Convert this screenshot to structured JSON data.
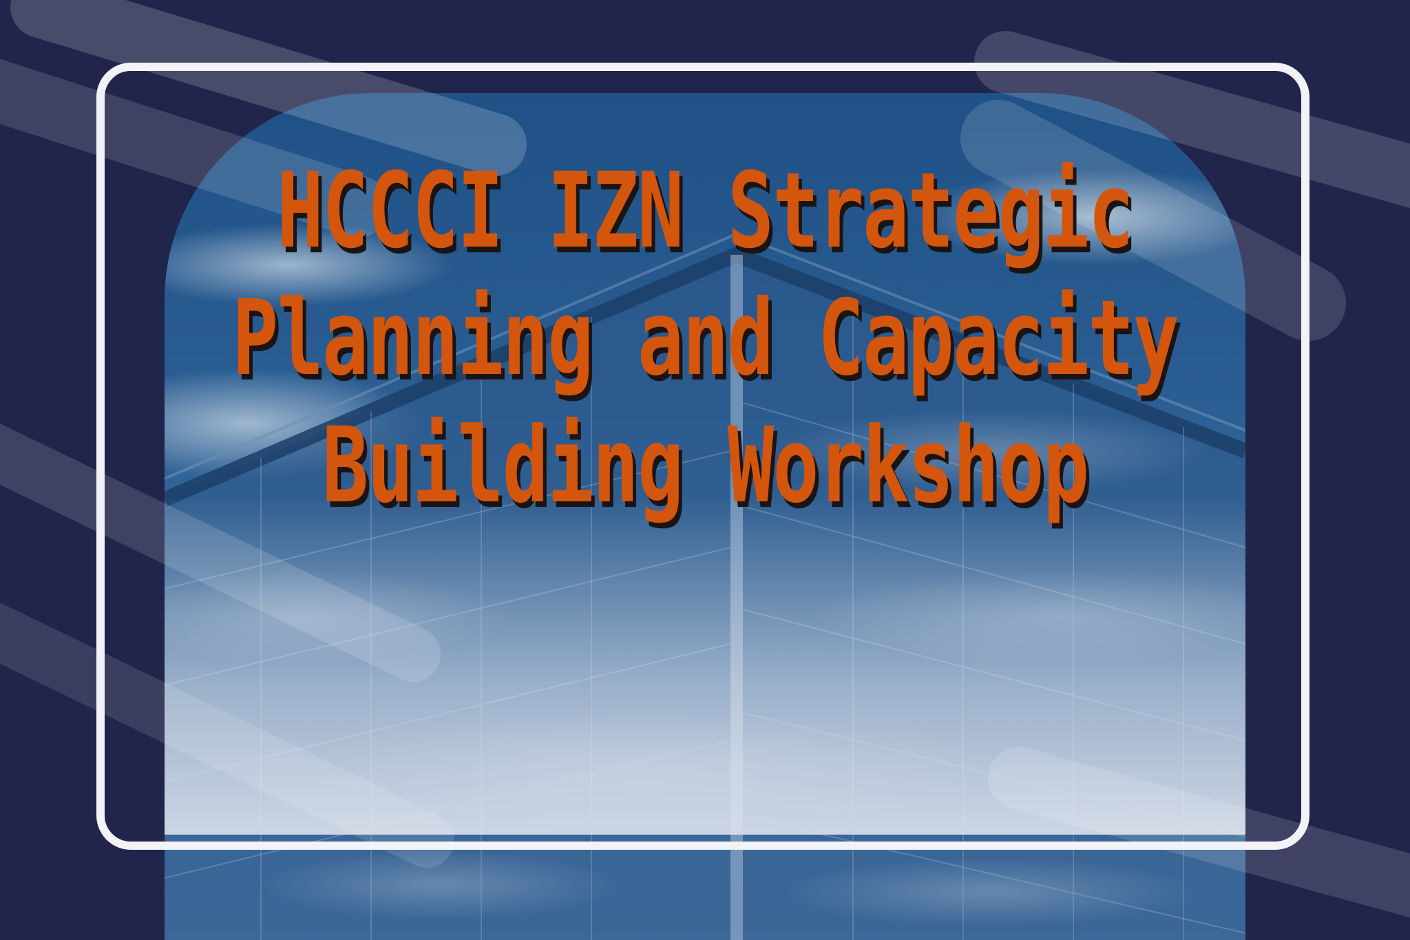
{
  "poster": {
    "title": "HCCCI IZN Strategic Planning and Capacity Building Workshop",
    "title_color": "#d4560c",
    "title_shadow_color": "#1b1414",
    "background_color": "#21244b",
    "frame_color": "#f2f3f7",
    "photo": "sky-and-glass-building-photo"
  }
}
